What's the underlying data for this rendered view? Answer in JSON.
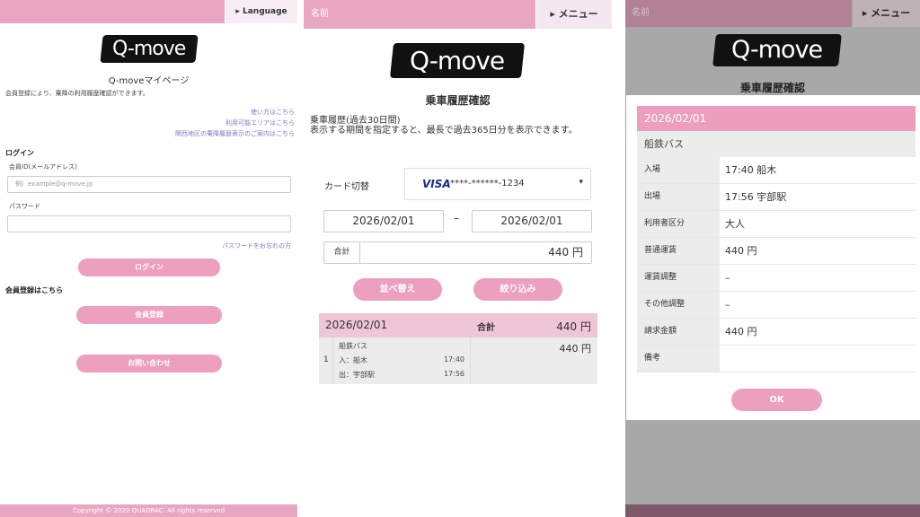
{
  "colors": {
    "accent_pink": "#e9a6c1",
    "button_pink": "#ec9fbe",
    "link": "#7a7ac8"
  },
  "login": {
    "language_label": "▸ Language",
    "logo_text": "Q-move",
    "title": "Q-moveマイページ",
    "description": "会員登録により、乗降の利用履歴確認ができます。",
    "links": [
      "使い方はこちら",
      "利用可能エリアはこちら",
      "関西地区の乗降履歴表示のご案内はこちら"
    ],
    "login_heading": "ログイン",
    "member_id_label": "会員ID(メールアドレス)",
    "member_id_placeholder": "例）example@q-move.jp",
    "password_label": "パスワード",
    "forgot_password": "パスワードをお忘れの方",
    "login_button": "ログイン",
    "register_heading": "会員登録はこちら",
    "register_button": "会員登録",
    "contact_button": "お問い合わせ",
    "copyright": "Copyright © 2020 QUADRAC. All rights reserved"
  },
  "history": {
    "name_label": "名前",
    "menu_label": "▸ メニュー",
    "logo_text": "Q-move",
    "title": "乗車履歴確認",
    "subtitle": "乗車履歴(過去30日間)",
    "description": "表示する期間を指定すると、最長で過去365日分を表示できます。",
    "card_label": "カード切替",
    "card_brand": "VISA",
    "card_number": "****-******-1234",
    "caret": "▾",
    "date_from": "2026/02/01",
    "date_separator": "–",
    "date_to": "2026/02/01",
    "total_label": "合計",
    "total_value": "440 円",
    "sort_button": "並べ替え",
    "filter_button": "絞り込み",
    "list_date": "2026/02/01",
    "list_total_label": "合計",
    "list_total_value": "440 円",
    "items": [
      {
        "index": "1",
        "line": "船鉄バス",
        "in_label": "入：船木",
        "in_time": "17:40",
        "out_label": "出：宇部駅",
        "out_time": "17:56",
        "amount": "440 円"
      }
    ]
  },
  "detail": {
    "name_label": "名前",
    "menu_label": "▸ メニュー",
    "logo_text": "Q-move",
    "title": "乗車履歴確認",
    "date": "2026/02/01",
    "line": "船鉄バス",
    "rows": [
      {
        "key": "入場",
        "value": "17:40 船木"
      },
      {
        "key": "出場",
        "value": "17:56 宇部駅"
      },
      {
        "key": "利用者区分",
        "value": "大人"
      },
      {
        "key": "普通運賃",
        "value": "440 円"
      },
      {
        "key": "運賃調整",
        "value": "–"
      },
      {
        "key": "その他調整",
        "value": "–"
      },
      {
        "key": "請求金額",
        "value": "440 円"
      },
      {
        "key": "備考",
        "value": ""
      }
    ],
    "ok_button": "OK"
  }
}
